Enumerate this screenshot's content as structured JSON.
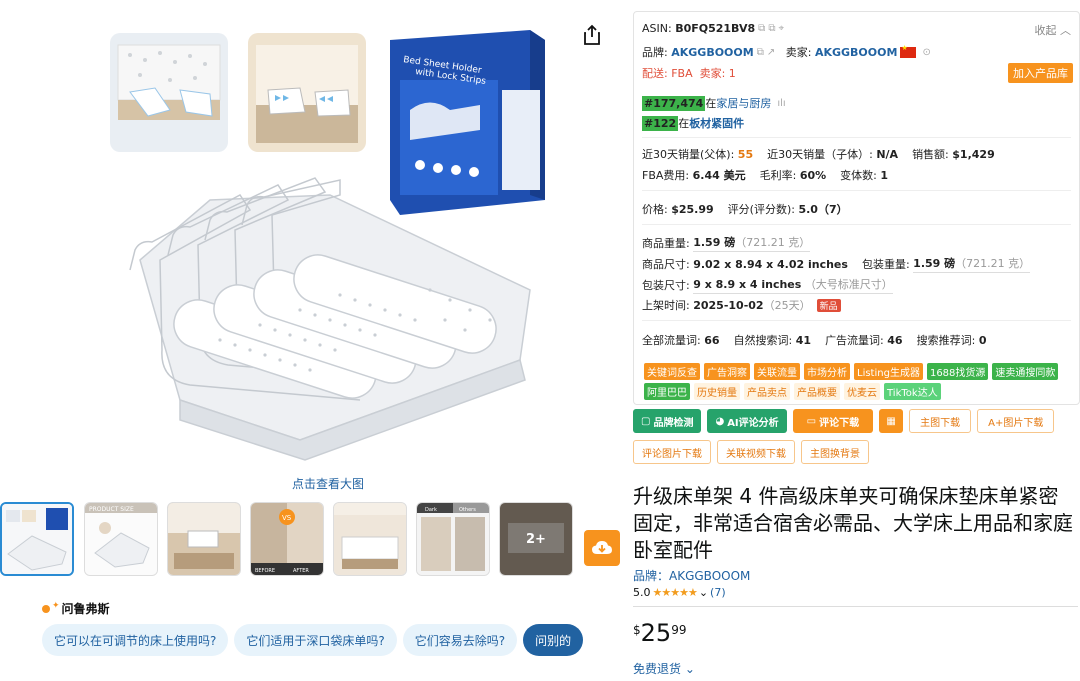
{
  "gallery": {
    "view_large": "点击查看大图",
    "box_text": "Bed Sheet Holder with Lock Strips",
    "more_count": "2+",
    "thumb_texts": [
      "PRODUCT SIZE",
      "VS",
      "BEFORE",
      "AFTER",
      "Dark",
      "Others"
    ]
  },
  "rufus": {
    "title": "问鲁弗斯",
    "questions": [
      "它可以在可调节的床上使用吗?",
      "它们适用于深口袋床单吗?",
      "它们容易去除吗?"
    ],
    "ask_label": "问别的"
  },
  "panel": {
    "asin_label": "ASIN:",
    "asin": "B0FQ521BV8",
    "collapse": "收起",
    "brand_label": "品牌:",
    "brand": "AKGGBOOOM",
    "seller_label": "卖家:",
    "seller": "AKGGBOOOM",
    "delivery": "配送: FBA",
    "seller_count": "卖家: 1",
    "add_library": "加入产品库",
    "rank1_num": "#177,474",
    "rank1_in": "在",
    "rank1_cat": "家居与厨房",
    "rank2_num": "#122",
    "rank2_in": "在",
    "rank2_cat": "板材紧固件",
    "sales30_parent_label": "近30天销量(父体):",
    "sales30_parent": "55",
    "sales30_child_label": "近30天销量（子体）:",
    "sales30_child": "N/A",
    "revenue_label": "销售额:",
    "revenue": "$1,429",
    "fba_fee_label": "FBA费用:",
    "fba_fee": "6.44 美元",
    "margin_label": "毛利率:",
    "margin": "60%",
    "variants_label": "变体数:",
    "variants": "1",
    "price_label": "价格:",
    "price": "$25.99",
    "rating_label": "评分(评分数):",
    "rating": "5.0（7）",
    "weight_label": "商品重量:",
    "weight": "1.59 磅",
    "weight_g": "（721.21 克）",
    "size_label": "商品尺寸:",
    "size": "9.02 x 8.94 x 4.02 inches",
    "pkg_weight_label": "包装重量:",
    "pkg_weight": "1.59 磅",
    "pkg_weight_g": "（721.21 克）",
    "pkg_size_label": "包装尺寸:",
    "pkg_size": "9 x 8.9 x 4 inches",
    "pkg_size_note": "（大号标准尺寸）",
    "listed_label": "上架时间:",
    "listed": "2025-10-02",
    "listed_days": "（25天）",
    "new_tag": "新品",
    "traffic_all_label": "全部流量词:",
    "traffic_all": "66",
    "traffic_organic_label": "自然搜索词:",
    "traffic_organic": "41",
    "traffic_ad_label": "广告流量词:",
    "traffic_ad": "46",
    "traffic_rec_label": "搜索推荐词:",
    "traffic_rec": "0",
    "tags_row1": [
      "关键词反查",
      "广告洞察",
      "关联流量",
      "市场分析",
      "Listing生成器",
      "1688找货源"
    ],
    "tags_row2": [
      "速卖通搜同款",
      "阿里巴巴",
      "历史销量",
      "产品卖点",
      "产品概要",
      "优麦云",
      "TikTok达人"
    ]
  },
  "tools": {
    "brand_check": "品牌检测",
    "ai_review": "AI评论分析",
    "review_download": "评论下载",
    "main_img_download": "主图下载",
    "aplus_download": "A+图片下载",
    "review_img_download": "评论图片下载",
    "video_download": "关联视频下载",
    "main_img_bg": "主图换背景"
  },
  "product": {
    "title": "升级床单架 4 件高级床单夹可确保床垫床单紧密固定，非常适合宿舍必需品、大学床上用品和家庭卧室配件",
    "brand_line": "品牌：AKGGBOOOM",
    "rating_value": "5.0",
    "stars": "★★★★★",
    "rating_count": "(7)",
    "price_symbol": "$",
    "price_whole": "25",
    "price_fraction": "99",
    "returns": "免费退货"
  },
  "colors": {
    "accent_orange": "#f7931e",
    "link_blue": "#2162a1",
    "green": "#3cb34a"
  }
}
